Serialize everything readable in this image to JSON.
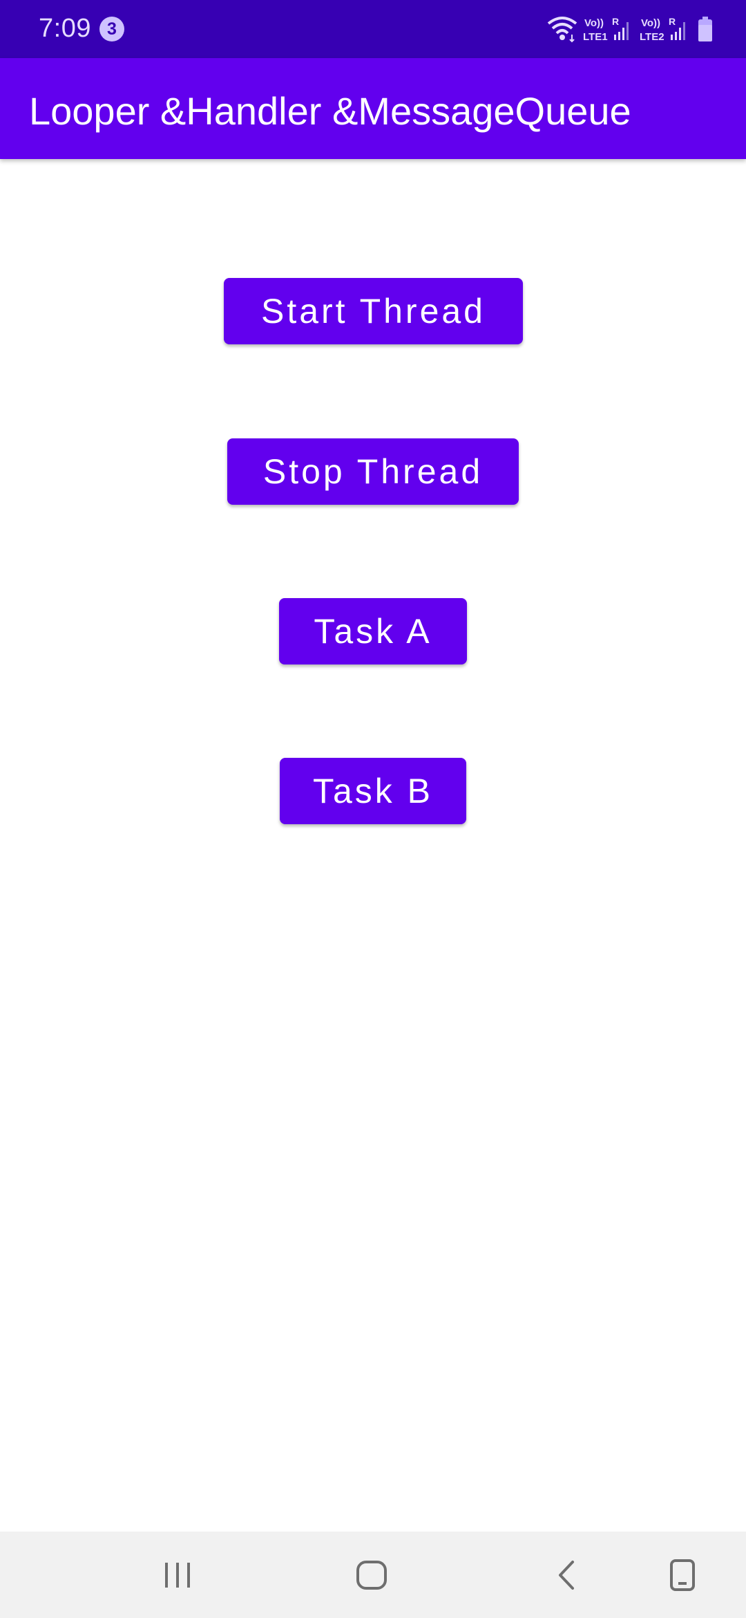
{
  "status_bar": {
    "time": "7:09",
    "notification_count": "3",
    "sim1_label": "LTE1",
    "sim2_label": "LTE2",
    "volte_label": "Vo))",
    "roaming_label": "R"
  },
  "app_bar": {
    "title": "Looper &Handler &MessageQueue"
  },
  "buttons": {
    "start": "Start Thread",
    "stop": "Stop Thread",
    "task_a": "Task A",
    "task_b": "Task B"
  },
  "nav_bar": {
    "icons": [
      "recent-apps-icon",
      "home-icon",
      "back-icon",
      "rotate-icon"
    ]
  },
  "colors": {
    "primary": "#6200EE",
    "primary_dark": "#3700B3",
    "background": "#FFFFFF",
    "nav_background": "#F1F1F1"
  }
}
